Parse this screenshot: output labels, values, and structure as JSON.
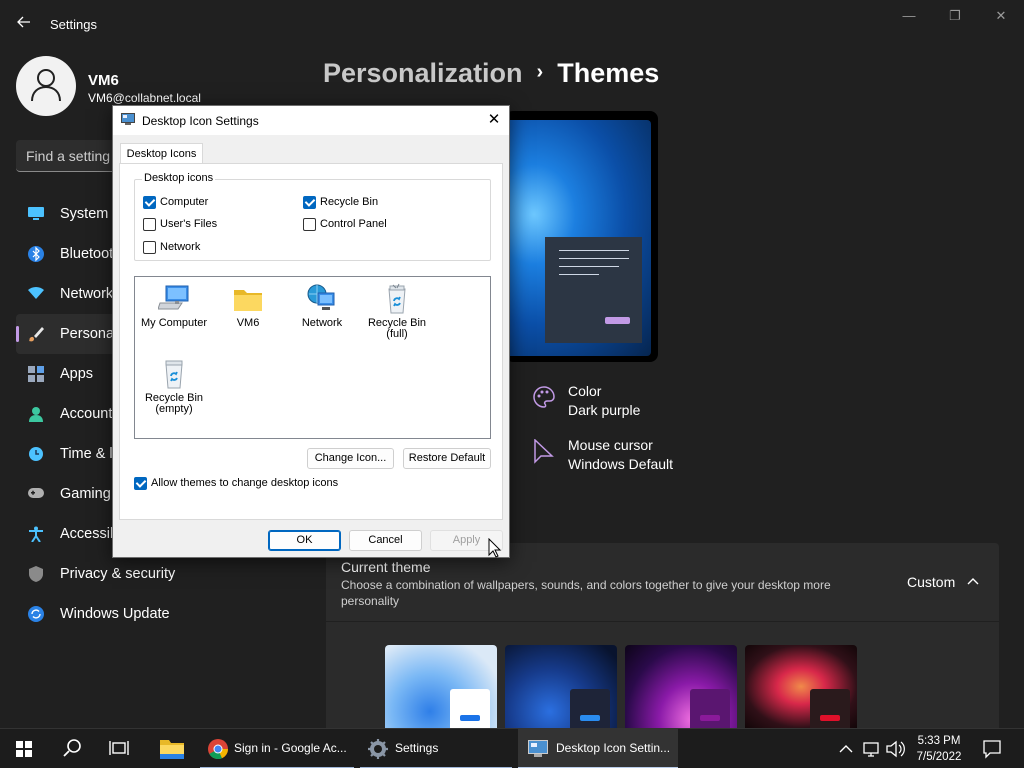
{
  "window": {
    "app_title": "Settings",
    "controls": {
      "minimize": "—",
      "maximize": "❐",
      "close": "✕"
    }
  },
  "profile": {
    "name": "VM6",
    "email": "VM6@collabnet.local"
  },
  "search": {
    "placeholder": "Find a setting"
  },
  "sidebar": {
    "items": [
      {
        "label": "System",
        "icon": "monitor-icon",
        "color": "#4cc2ff"
      },
      {
        "label": "Bluetooth & devices",
        "icon": "bluetooth-icon",
        "color": "#4aa3ff"
      },
      {
        "label": "Network & internet",
        "icon": "wifi-icon",
        "color": "#4cc2ff"
      },
      {
        "label": "Personalization",
        "icon": "brush-icon",
        "color": "#e8a060",
        "active": true
      },
      {
        "label": "Apps",
        "icon": "apps-icon",
        "color": "#9aa8bd"
      },
      {
        "label": "Accounts",
        "icon": "person-icon",
        "color": "#3cc8a0"
      },
      {
        "label": "Time & language",
        "icon": "clock-globe-icon",
        "color": "#4cc2ff"
      },
      {
        "label": "Gaming",
        "icon": "gamepad-icon",
        "color": "#b0b0b0"
      },
      {
        "label": "Accessibility",
        "icon": "accessibility-icon",
        "color": "#4cc2ff"
      },
      {
        "label": "Privacy & security",
        "icon": "shield-icon",
        "color": "#9a9a9a"
      },
      {
        "label": "Windows Update",
        "icon": "update-icon",
        "color": "#4cc2ff"
      }
    ]
  },
  "breadcrumb": {
    "parent": "Personalization",
    "separator": "›",
    "current": "Themes"
  },
  "theme_props": {
    "color": {
      "title": "Color",
      "value": "Dark purple"
    },
    "cursor": {
      "title": "Mouse cursor",
      "value": "Windows Default"
    }
  },
  "current_theme": {
    "title": "Current theme",
    "description": "Choose a combination of wallpapers, sounds, and colors together to give your desktop more personality",
    "value": "Custom",
    "chevron": "︿"
  },
  "dialog": {
    "title": "Desktop Icon Settings",
    "close": "✕",
    "tab": "Desktop Icons",
    "group_label": "Desktop icons",
    "checkboxes": [
      {
        "label": "Computer",
        "checked": true
      },
      {
        "label": "Recycle Bin",
        "checked": true
      },
      {
        "label": "User's Files",
        "checked": false
      },
      {
        "label": "Control Panel",
        "checked": false
      },
      {
        "label": "Network",
        "checked": false
      }
    ],
    "icons": [
      {
        "label": "My Computer",
        "icon": "computer-icon"
      },
      {
        "label": "VM6",
        "icon": "folder-icon"
      },
      {
        "label": "Network",
        "icon": "network-icon"
      },
      {
        "label": "Recycle Bin (full)",
        "icon": "recycle-bin-full-icon"
      },
      {
        "label": "Recycle Bin (empty)",
        "icon": "recycle-bin-empty-icon"
      }
    ],
    "change_icon": "Change Icon...",
    "restore_default": "Restore Default",
    "allow_themes": {
      "label": "Allow themes to change desktop icons",
      "checked": true
    },
    "ok": "OK",
    "cancel": "Cancel",
    "apply": "Apply"
  },
  "taskbar": {
    "apps": [
      {
        "label": "Sign in - Google Ac...",
        "icon": "chrome-icon"
      },
      {
        "label": "Settings",
        "icon": "settings-gear-icon"
      },
      {
        "label": "Desktop Icon Settin...",
        "icon": "desktop-icon-settings-icon",
        "active": true
      }
    ],
    "clock": {
      "time": "5:33 PM",
      "date": "7/5/2022"
    }
  },
  "colors": {
    "accent": "#c29ae6",
    "checkbox": "#0067c0"
  }
}
